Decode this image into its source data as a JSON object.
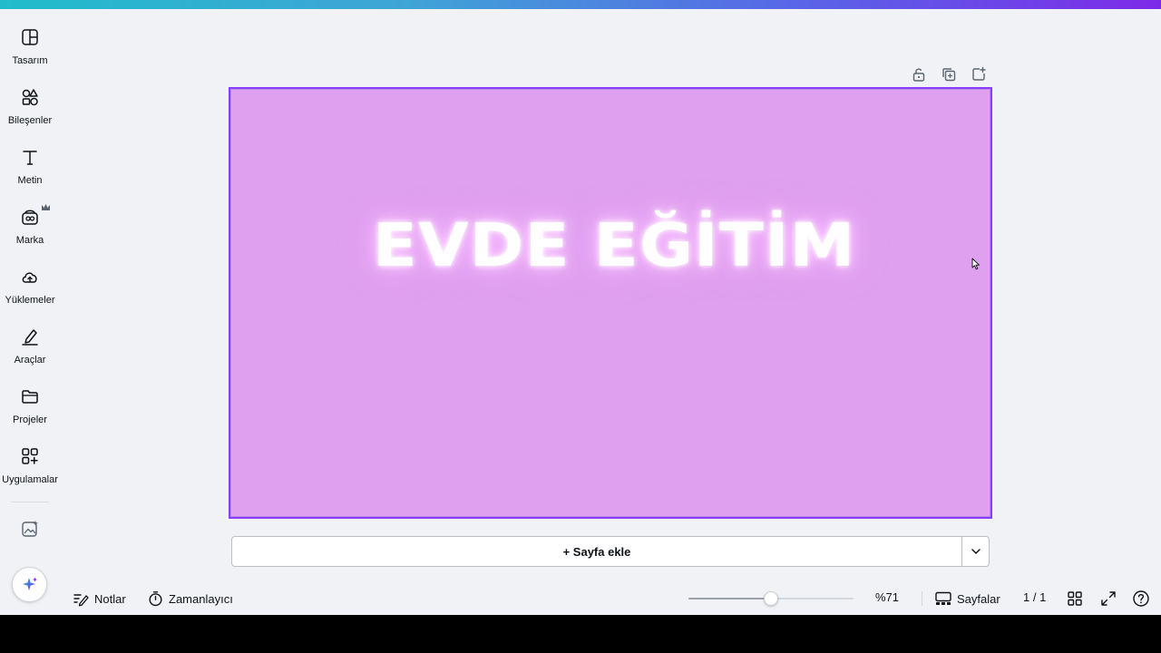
{
  "sidebar": {
    "items": [
      {
        "label": "Tasarım",
        "icon": "layout-icon"
      },
      {
        "label": "Bileşenler",
        "icon": "shapes-icon"
      },
      {
        "label": "Metin",
        "icon": "text-icon"
      },
      {
        "label": "Marka",
        "icon": "brand-icon"
      },
      {
        "label": "Yüklemeler",
        "icon": "cloud-upload-icon"
      },
      {
        "label": "Araçlar",
        "icon": "pen-tool-icon"
      },
      {
        "label": "Projeler",
        "icon": "folder-icon"
      },
      {
        "label": "Uygulamalar",
        "icon": "apps-grid-icon"
      }
    ]
  },
  "canvas": {
    "headline": "EVDE EĞİTİM",
    "background_color": "#dfa0ef",
    "selection_color": "#8b3dff"
  },
  "add_page": {
    "label": "+ Sayfa ekle"
  },
  "bottombar": {
    "notes_label": "Notlar",
    "timer_label": "Zamanlayıcı",
    "zoom_value": "%71",
    "zoom_level": 0.5,
    "pages_label": "Sayfalar",
    "page_count": "1 / 1"
  },
  "accent": {
    "gradient_start": "#21bccb",
    "gradient_end": "#7d2ae8"
  }
}
